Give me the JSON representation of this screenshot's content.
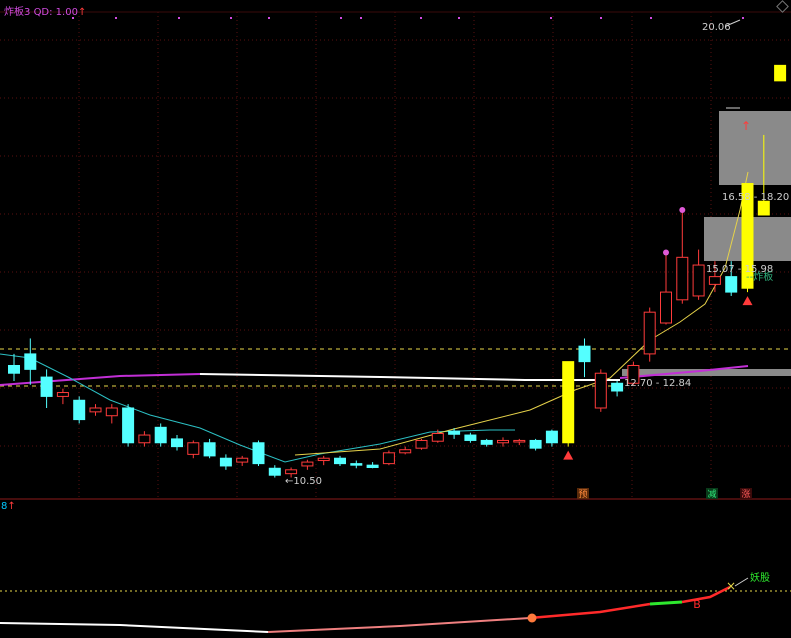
{
  "header": {
    "indicator_name": "炸板3",
    "qd_label": "QD: 1.00",
    "arrow": "↑"
  },
  "sub_header": {
    "value": "8",
    "arrow": "↑"
  },
  "colors": {
    "up": "#ff3b3b",
    "down": "#54ffff",
    "limit_up": "#ffff00",
    "ma_purple": "#c22fd6",
    "ma_white": "#ffffff",
    "ma_cyan": "#2cc0c4",
    "ma_yellow": "#e6d24a",
    "gray_zone": "#8a8a8a",
    "grid": "#5a0f0f"
  },
  "chart_data": [
    {
      "type": "candlestick",
      "title": "",
      "annotations": {
        "low_label": "←10.50",
        "high_label": "20.06",
        "zones": [
          {
            "label": "12.70 - 12.84"
          },
          {
            "label": "15.07 - 15.98"
          },
          {
            "label": "16.58 - 18.20"
          }
        ],
        "tag_zhaban": "--炸板",
        "markers": [
          "预",
          "减",
          "涨"
        ]
      },
      "candles": [
        {
          "o": 11.85,
          "c": 11.95,
          "h": 12.1,
          "l": 11.75,
          "color": "down"
        },
        {
          "o": 12.1,
          "c": 11.9,
          "h": 12.3,
          "l": 11.7,
          "color": "down"
        },
        {
          "o": 11.8,
          "c": 11.55,
          "h": 11.9,
          "l": 11.4,
          "color": "down"
        },
        {
          "o": 11.55,
          "c": 11.6,
          "h": 11.65,
          "l": 11.45,
          "color": "up"
        },
        {
          "o": 11.5,
          "c": 11.25,
          "h": 11.55,
          "l": 11.2,
          "color": "down"
        },
        {
          "o": 11.35,
          "c": 11.4,
          "h": 11.45,
          "l": 11.3,
          "color": "up"
        },
        {
          "o": 11.4,
          "c": 11.3,
          "h": 11.45,
          "l": 11.2,
          "color": "up"
        },
        {
          "o": 11.4,
          "c": 10.95,
          "h": 11.45,
          "l": 10.9,
          "color": "down"
        },
        {
          "o": 10.95,
          "c": 11.05,
          "h": 11.1,
          "l": 10.9,
          "color": "up"
        },
        {
          "o": 11.15,
          "c": 10.95,
          "h": 11.2,
          "l": 10.9,
          "color": "down"
        },
        {
          "o": 11.0,
          "c": 10.9,
          "h": 11.05,
          "l": 10.85,
          "color": "down"
        },
        {
          "o": 10.8,
          "c": 10.95,
          "h": 10.98,
          "l": 10.75,
          "color": "up"
        },
        {
          "o": 10.95,
          "c": 10.78,
          "h": 11.0,
          "l": 10.75,
          "color": "down"
        },
        {
          "o": 10.75,
          "c": 10.65,
          "h": 10.8,
          "l": 10.6,
          "color": "down"
        },
        {
          "o": 10.7,
          "c": 10.75,
          "h": 10.78,
          "l": 10.65,
          "color": "up"
        },
        {
          "o": 10.95,
          "c": 10.68,
          "h": 10.98,
          "l": 10.65,
          "color": "down"
        },
        {
          "o": 10.62,
          "c": 10.53,
          "h": 10.66,
          "l": 10.5,
          "color": "down"
        },
        {
          "o": 10.55,
          "c": 10.6,
          "h": 10.63,
          "l": 10.5,
          "color": "up"
        },
        {
          "o": 10.65,
          "c": 10.7,
          "h": 10.73,
          "l": 10.6,
          "color": "up"
        },
        {
          "o": 10.72,
          "c": 10.75,
          "h": 10.78,
          "l": 10.66,
          "color": "up"
        },
        {
          "o": 10.75,
          "c": 10.68,
          "h": 10.78,
          "l": 10.65,
          "color": "down"
        },
        {
          "o": 10.68,
          "c": 10.66,
          "h": 10.72,
          "l": 10.62,
          "color": "down"
        },
        {
          "o": 10.66,
          "c": 10.63,
          "h": 10.7,
          "l": 10.62,
          "color": "down"
        },
        {
          "o": 10.68,
          "c": 10.82,
          "h": 10.85,
          "l": 10.66,
          "color": "up"
        },
        {
          "o": 10.82,
          "c": 10.86,
          "h": 10.9,
          "l": 10.8,
          "color": "up"
        },
        {
          "o": 10.88,
          "c": 10.98,
          "h": 11.0,
          "l": 10.86,
          "color": "up"
        },
        {
          "o": 10.97,
          "c": 11.07,
          "h": 11.12,
          "l": 10.95,
          "color": "up"
        },
        {
          "o": 11.06,
          "c": 11.1,
          "h": 11.14,
          "l": 11.0,
          "color": "down"
        },
        {
          "o": 11.05,
          "c": 10.98,
          "h": 11.08,
          "l": 10.95,
          "color": "down"
        },
        {
          "o": 10.98,
          "c": 10.93,
          "h": 11.0,
          "l": 10.9,
          "color": "down"
        },
        {
          "o": 10.98,
          "c": 10.95,
          "h": 11.02,
          "l": 10.9,
          "color": "up"
        },
        {
          "o": 10.98,
          "c": 10.96,
          "h": 11.0,
          "l": 10.92,
          "color": "up"
        },
        {
          "o": 10.98,
          "c": 10.88,
          "h": 11.0,
          "l": 10.85,
          "color": "down"
        },
        {
          "o": 11.1,
          "c": 10.95,
          "h": 11.12,
          "l": 10.9,
          "color": "down"
        },
        {
          "o": 10.95,
          "c": 12.0,
          "h": 12.0,
          "l": 10.9,
          "color": "limit_up",
          "marker": "arrow"
        },
        {
          "o": 12.0,
          "c": 12.2,
          "h": 12.3,
          "l": 11.8,
          "color": "down"
        },
        {
          "o": 11.4,
          "c": 11.85,
          "h": 11.9,
          "l": 11.35,
          "color": "up"
        },
        {
          "o": 11.72,
          "c": 11.62,
          "h": 11.75,
          "l": 11.55,
          "color": "down"
        },
        {
          "o": 11.72,
          "c": 11.95,
          "h": 12.0,
          "l": 11.7,
          "color": "up"
        },
        {
          "o": 12.1,
          "c": 12.64,
          "h": 12.7,
          "l": 12.0,
          "color": "up"
        },
        {
          "o": 12.5,
          "c": 12.9,
          "h": 13.4,
          "l": 12.48,
          "color": "up",
          "marker": "dot"
        },
        {
          "o": 12.8,
          "c": 13.35,
          "h": 13.95,
          "l": 12.75,
          "color": "up",
          "marker": "dot"
        },
        {
          "o": 12.85,
          "c": 13.25,
          "h": 13.45,
          "l": 12.8,
          "color": "up"
        },
        {
          "o": 13.1,
          "c": 13.0,
          "h": 13.3,
          "l": 12.9,
          "color": "up"
        },
        {
          "o": 13.1,
          "c": 12.9,
          "h": 13.3,
          "l": 12.85,
          "color": "down"
        },
        {
          "o": 12.95,
          "c": 14.5,
          "h": 14.5,
          "l": 12.9,
          "color": "limit_up",
          "marker": "arrow"
        },
        {
          "o": 16.58,
          "c": 16.9,
          "h": 16.9,
          "l": 16.3,
          "color": "limit_up"
        },
        {
          "o": 19.7,
          "c": 20.06,
          "h": 20.06,
          "l": 19.7,
          "color": "limit_up"
        }
      ],
      "sub_chart": {
        "labels": [
          "B",
          "妖股"
        ],
        "markers": [
          "×"
        ]
      }
    }
  ]
}
